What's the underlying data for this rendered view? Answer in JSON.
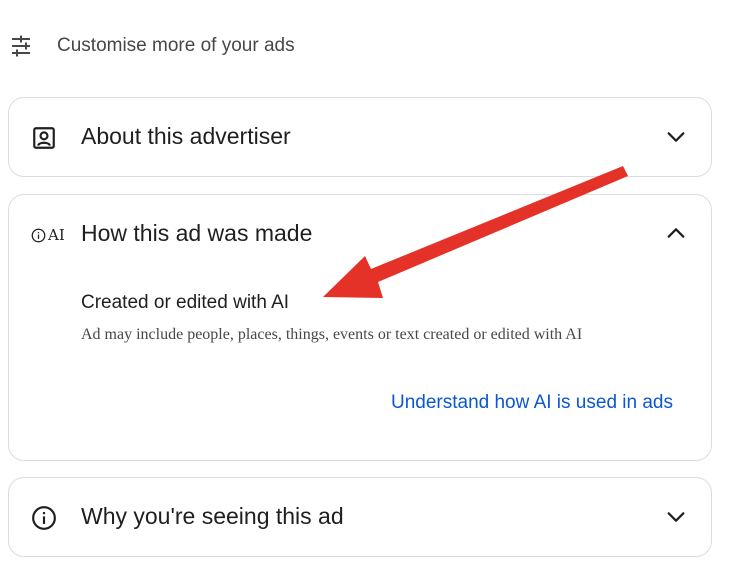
{
  "customise": {
    "label": "Customise more of your ads",
    "icon": "tune-sliders-icon"
  },
  "cards": {
    "about": {
      "title": "About this advertiser",
      "icon": "account-box-icon",
      "expanded": false
    },
    "how": {
      "title": "How this ad was made",
      "icon_text": "AI",
      "icon": "info-ai-icon",
      "expanded": true,
      "subtitle": "Created or edited with AI",
      "description": "Ad may include people, places, things, events or text created or edited with AI",
      "link_label": "Understand how AI is used in ads"
    },
    "why": {
      "title": "Why you're seeing this ad",
      "icon": "info-icon",
      "expanded": false
    }
  },
  "colors": {
    "link": "#0b57d0",
    "border": "#dadce0",
    "annotation_arrow": "#e53228"
  }
}
